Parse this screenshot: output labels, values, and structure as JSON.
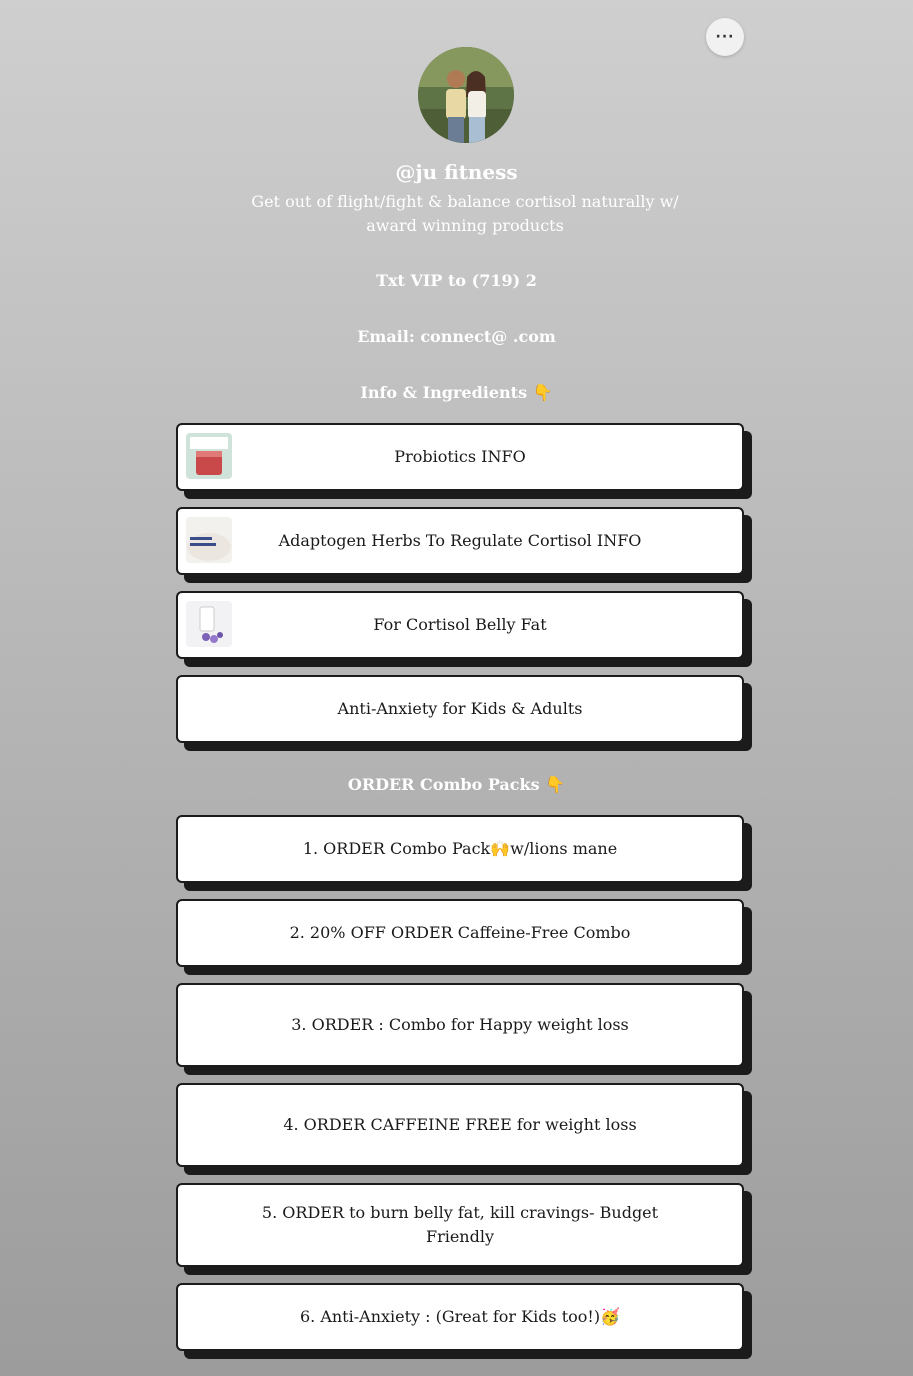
{
  "profile": {
    "more_icon_glyph": "···",
    "handle": "@ju          fitness",
    "bio": "Get out of flight/fight & balance cortisol naturally w/ award winning products",
    "txt_vip": "Txt VIP to (719) 2",
    "email": "Email: connect@                    .com"
  },
  "sections": {
    "info_header": "Info & Ingredients 👇",
    "order_header": "ORDER Combo Packs 👇"
  },
  "info_links": [
    {
      "label": "Probiotics INFO",
      "thumb": "probiotic-drink-thumbnail"
    },
    {
      "label": "Adaptogen Herbs To Regulate Cortisol INFO",
      "thumb": "mood-support-thumbnail"
    },
    {
      "label": "For Cortisol Belly Fat",
      "thumb": "supplement-bottle-thumbnail"
    },
    {
      "label": "Anti-Anxiety               for Kids & Adults"
    }
  ],
  "order_links": [
    {
      "label": "1. ORDER                Combo Pack🙌w/lions mane"
    },
    {
      "label": "2. 20% OFF ORDER Caffeine-Free                Combo"
    },
    {
      "label": "3. ORDER                                      : Combo for Happy weight loss"
    },
    {
      "label": "4. ORDER CAFFEINE FREE                                     for weight loss"
    },
    {
      "label": "5. ORDER                         to burn belly fat, kill cravings- Budget Friendly"
    },
    {
      "label": "6. Anti-Anxiety              : (Great for Kids too!)🥳"
    }
  ]
}
